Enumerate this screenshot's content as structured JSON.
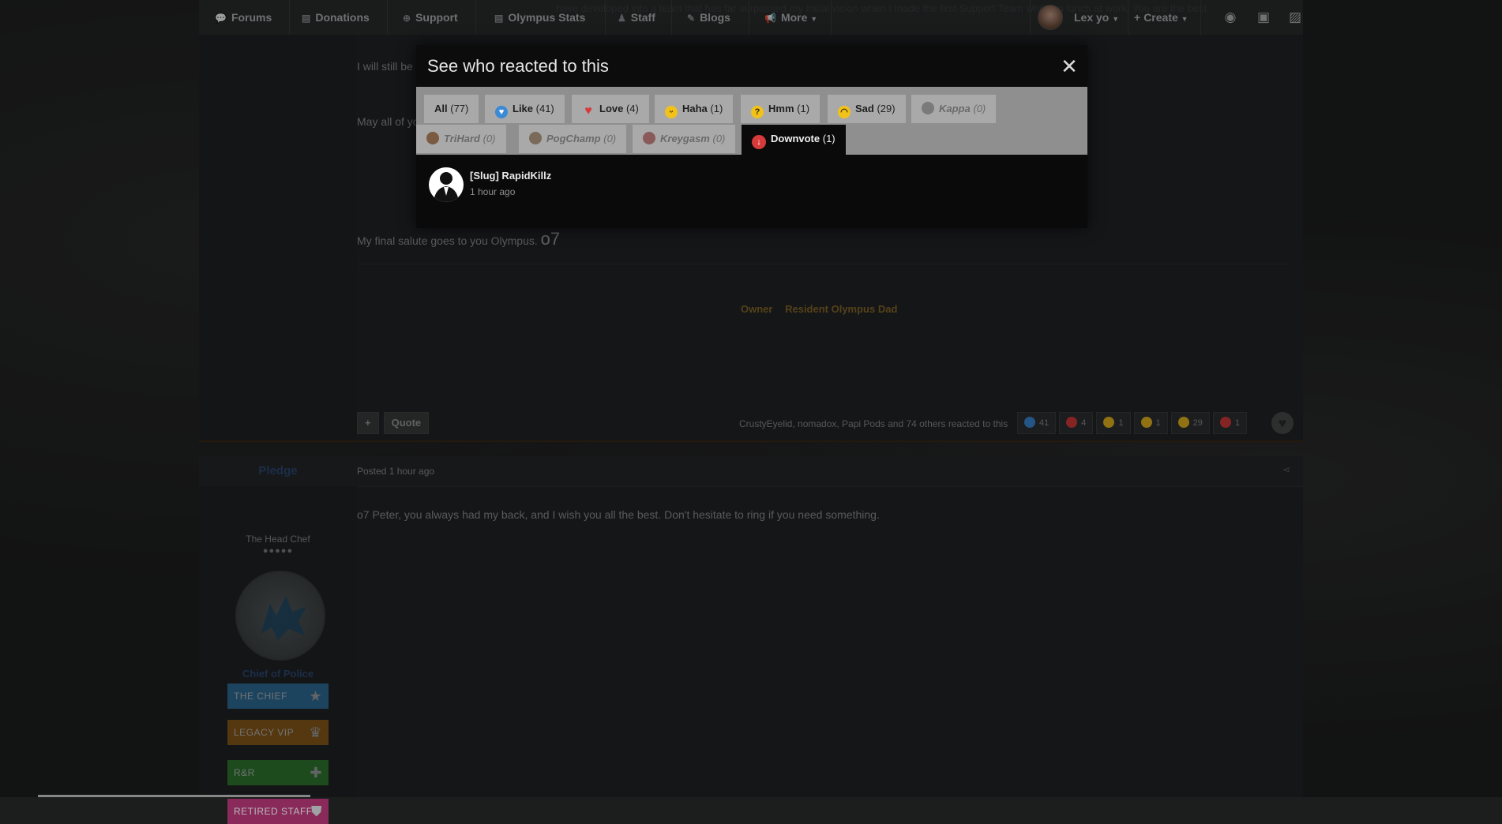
{
  "nav": {
    "items": [
      {
        "label": "Forums",
        "icon": "comments-icon"
      },
      {
        "label": "Donations",
        "icon": "document-icon"
      },
      {
        "label": "Support",
        "icon": "lifebuoy-icon"
      },
      {
        "label": "Olympus Stats",
        "icon": "document-icon"
      },
      {
        "label": "Staff",
        "icon": "user-icon"
      },
      {
        "label": "Blogs",
        "icon": "book-icon"
      },
      {
        "label": "More",
        "icon": "megaphone-icon"
      }
    ],
    "ticker": "have developed into a team that has far surpassed my initial vision when I made the first Support Team while on lunch at work. You are the best.",
    "username": "Lex yo",
    "create_label": "Create"
  },
  "post1": {
    "line1": "I will still be",
    "line2": "May all of yo",
    "closing": "My final salute goes to you Olympus.",
    "o7": "o7",
    "rank_tags": [
      "Owner",
      "Resident Olympus Dad"
    ],
    "quote_label": "Quote",
    "reactors_text": "CrustyEyelid, nomadox, Papi Pods and 74 others reacted to this",
    "reaction_counts": [
      {
        "name": "like",
        "count": "41",
        "color": "#3a8ad6"
      },
      {
        "name": "love",
        "count": "4",
        "color": "#d63a3a"
      },
      {
        "name": "haha",
        "count": "1",
        "color": "#e8b820"
      },
      {
        "name": "hmm",
        "count": "1",
        "color": "#e8b820"
      },
      {
        "name": "sad",
        "count": "29",
        "color": "#e8b820"
      },
      {
        "name": "downvote",
        "count": "1",
        "color": "#d63a3a"
      }
    ]
  },
  "post2": {
    "author": "Pledge",
    "posted": "Posted 1 hour ago",
    "user_title": "The Head Chef",
    "pips": "●●●●●",
    "group": "Chief of Police",
    "badges": [
      {
        "label": "THE CHIEF",
        "color": "#2f6f9a"
      },
      {
        "label": "LEGACY VIP",
        "color": "#8a5a1a"
      },
      {
        "label": "R&R",
        "color": "#2f7a2f"
      },
      {
        "label": "RETIRED STAFF",
        "color": "#8a2a5a"
      }
    ],
    "text": "o7 Peter, you always had my back, and I wish you all the best. Don't hesitate to ring if you need something."
  },
  "modal": {
    "title": "See who reacted to this",
    "tabs": [
      {
        "label": "All",
        "count": "(77)",
        "emoji": "none"
      },
      {
        "label": "Like",
        "count": "(41)",
        "emoji": "like",
        "color": "#3a8ad6"
      },
      {
        "label": "Love",
        "count": "(4)",
        "emoji": "love",
        "color": "#d63a3a"
      },
      {
        "label": "Haha",
        "count": "(1)",
        "emoji": "haha",
        "color": "#f2c21a"
      },
      {
        "label": "Hmm",
        "count": "(1)",
        "emoji": "hmm",
        "color": "#f2c21a"
      },
      {
        "label": "Sad",
        "count": "(29)",
        "emoji": "sad",
        "color": "#f2c21a"
      },
      {
        "label": "Kappa",
        "count": "(0)",
        "emoji": "kappa",
        "color": "#7a7a7a"
      },
      {
        "label": "TriHard",
        "count": "(0)",
        "emoji": "trihard",
        "color": "#7a5a40"
      },
      {
        "label": "PogChamp",
        "count": "(0)",
        "emoji": "pogchamp",
        "color": "#7a6a5a"
      },
      {
        "label": "Kreygasm",
        "count": "(0)",
        "emoji": "kreygasm",
        "color": "#8a5a5a"
      },
      {
        "label": "Downvote",
        "count": "(1)",
        "emoji": "downvote",
        "color": "#d63a3a"
      }
    ],
    "active_tab": "Downvote",
    "reactor": {
      "name": "[Slug] RapidKillz",
      "time": "1 hour ago"
    }
  }
}
